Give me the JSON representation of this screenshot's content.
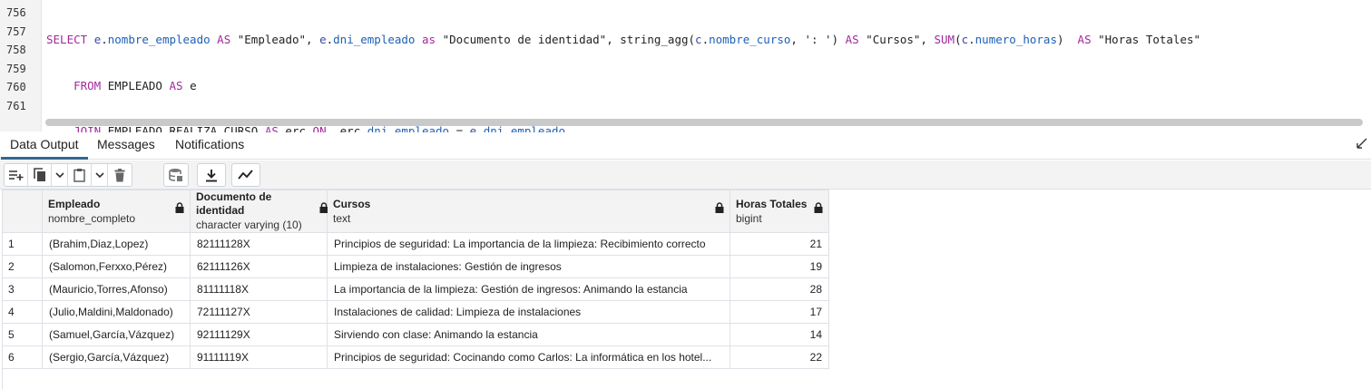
{
  "editor": {
    "line_numbers": [
      "756",
      "757",
      "758",
      "759",
      "760",
      "761"
    ]
  },
  "tabs": [
    {
      "label": "Data Output"
    },
    {
      "label": "Messages"
    },
    {
      "label": "Notifications"
    }
  ],
  "toolbar": {
    "icons": [
      "add-row-icon",
      "copy-icon",
      "chevron-down-icon",
      "paste-icon",
      "chevron-down-icon",
      "delete-icon",
      "save-data-icon",
      "download-icon",
      "graph-icon"
    ]
  },
  "grid": {
    "columns": [
      {
        "name": "Empleado",
        "type": "nombre_completo"
      },
      {
        "name": "Documento de identidad",
        "type": "character varying (10)"
      },
      {
        "name": "Cursos",
        "type": "text"
      },
      {
        "name": "Horas Totales",
        "type": "bigint"
      }
    ],
    "rows": [
      {
        "n": "1",
        "empleado": "(Brahim,Diaz,Lopez)",
        "dni": "82111128X",
        "cursos": "Principios de seguridad: La importancia de la limpieza: Recibimiento correcto",
        "horas": "21"
      },
      {
        "n": "2",
        "empleado": "(Salomon,Ferxxo,Pérez)",
        "dni": "62111126X",
        "cursos": "Limpieza de instalaciones: Gestión de ingresos",
        "horas": "19"
      },
      {
        "n": "3",
        "empleado": "(Mauricio,Torres,Afonso)",
        "dni": "81111118X",
        "cursos": "La importancia de la limpieza: Gestión de ingresos: Animando la estancia",
        "horas": "28"
      },
      {
        "n": "4",
        "empleado": "(Julio,Maldini,Maldonado)",
        "dni": "72111127X",
        "cursos": "Instalaciones de calidad: Limpieza de instalaciones",
        "horas": "17"
      },
      {
        "n": "5",
        "empleado": "(Samuel,García,Vázquez)",
        "dni": "92111129X",
        "cursos": "Sirviendo con clase: Animando la estancia",
        "horas": "14"
      },
      {
        "n": "6",
        "empleado": "(Sergio,García,Vázquez)",
        "dni": "91111119X",
        "cursos": "Principios de seguridad: Cocinando como Carlos: La informática en los hotel...",
        "horas": "22"
      }
    ]
  },
  "colors": {
    "keyword": "#a3299c",
    "alias": "#3949a8",
    "column": "#1e60b5",
    "active_tab": "#326690"
  }
}
